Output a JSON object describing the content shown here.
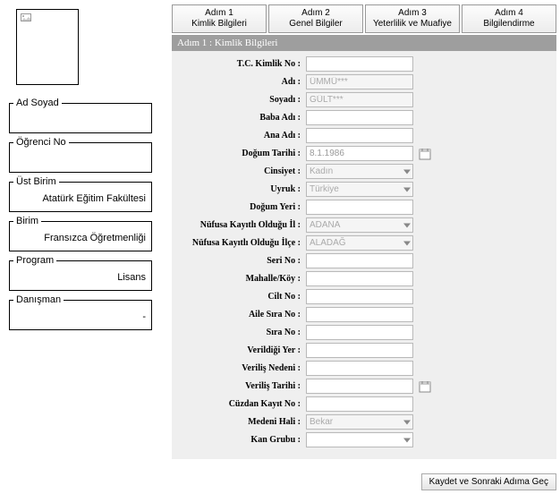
{
  "sidebar": {
    "ad_soyad_label": "Ad Soyad",
    "ad_soyad_value": "",
    "ogrenci_no_label": "Öğrenci No",
    "ogrenci_no_value": "",
    "ust_birim_label": "Üst Birim",
    "ust_birim_value": "Atatürk Eğitim Fakültesi",
    "birim_label": "Birim",
    "birim_value": "Fransızca Öğretmenliği",
    "program_label": "Program",
    "program_value": "Lisans",
    "danisman_label": "Danışman",
    "danisman_value": "-"
  },
  "steps": [
    {
      "line1": "Adım 1",
      "line2": "Kimlik Bilgileri"
    },
    {
      "line1": "Adım 2",
      "line2": "Genel Bilgiler"
    },
    {
      "line1": "Adım 3",
      "line2": "Yeterlilik ve Muafiye"
    },
    {
      "line1": "Adım 4",
      "line2": "Bilgilendirme"
    }
  ],
  "section_title": "Adım 1 : Kimlik Bilgileri",
  "form": {
    "tc_label": "T.C. Kimlik No :",
    "tc_value": "",
    "adi_label": "Adı :",
    "adi_value": "ÜMMÜ***",
    "soyadi_label": "Soyadı :",
    "soyadi_value": "GÜLT***",
    "baba_label": "Baba Adı :",
    "baba_value": "",
    "ana_label": "Ana Adı :",
    "ana_value": "",
    "dogum_tarihi_label": "Doğum Tarihi :",
    "dogum_tarihi_value": "8.1.1986",
    "cinsiyet_label": "Cinsiyet :",
    "cinsiyet_value": "Kadın",
    "uyruk_label": "Uyruk :",
    "uyruk_value": "Türkiye",
    "dogum_yeri_label": "Doğum Yeri :",
    "dogum_yeri_value": "",
    "nufus_il_label": "Nüfusa Kayıtlı Olduğu İl :",
    "nufus_il_value": "ADANA",
    "nufus_ilce_label": "Nüfusa Kayıtlı Olduğu İlçe :",
    "nufus_ilce_value": "ALADAĞ",
    "seri_label": "Seri No :",
    "seri_value": "",
    "mahalle_label": "Mahalle/Köy :",
    "mahalle_value": "",
    "cilt_label": "Cilt No :",
    "cilt_value": "",
    "aile_sira_label": "Aile Sıra No :",
    "aile_sira_value": "",
    "sira_label": "Sıra No :",
    "sira_value": "",
    "verildigi_yer_label": "Verildiği Yer :",
    "verildigi_yer_value": "",
    "verilis_nedeni_label": "Veriliş Nedeni :",
    "verilis_nedeni_value": "",
    "verilis_tarihi_label": "Veriliş Tarihi :",
    "verilis_tarihi_value": "",
    "cuzdan_label": "Cüzdan Kayıt No :",
    "cuzdan_value": "",
    "medeni_label": "Medeni Hali :",
    "medeni_value": "Bekar",
    "kan_label": "Kan Grubu :",
    "kan_value": ""
  },
  "footer_button": "Kaydet ve Sonraki Adıma Geç"
}
